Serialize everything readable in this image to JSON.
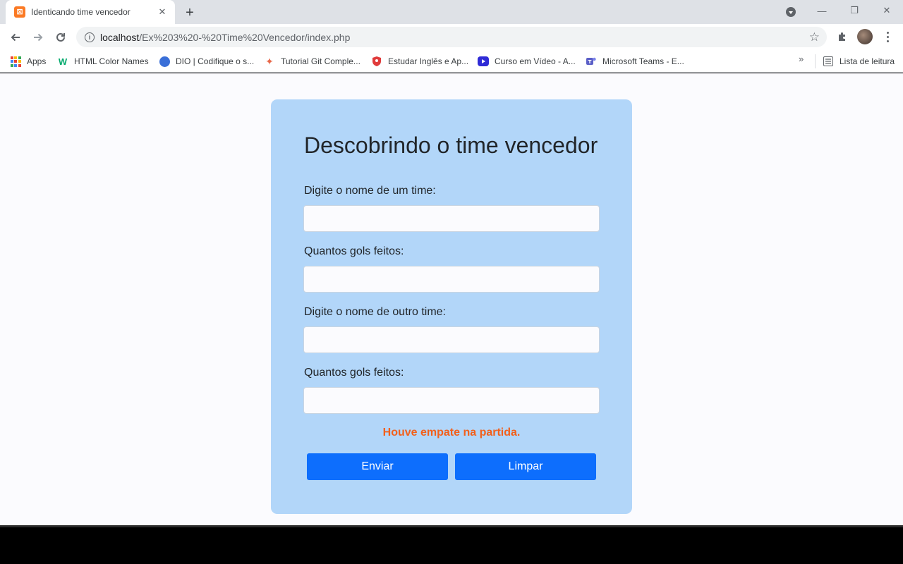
{
  "browser": {
    "tab": {
      "title": "Identicando time vencedor",
      "favicon_letter": "⊠"
    },
    "new_tab_symbol": "+",
    "window_buttons": {
      "minimize": "—",
      "restore": "❐",
      "close": "✕"
    },
    "url": {
      "host": "localhost",
      "path": "/Ex%203%20-%20Time%20Vencedor/index.php"
    },
    "bookmarks": [
      {
        "label": "Apps",
        "icon": "apps-grid-icon"
      },
      {
        "label": "HTML Color Names",
        "icon": "w3schools-icon",
        "color": "#04aa6d"
      },
      {
        "label": "DIO | Codifique o s...",
        "icon": "dio-icon",
        "color": "#3a6fd8"
      },
      {
        "label": "Tutorial Git Comple...",
        "icon": "git-icon",
        "color": "#e8684a"
      },
      {
        "label": "Estudar Inglês e Ap...",
        "icon": "shield-icon",
        "color": "#e03b3b"
      },
      {
        "label": "Curso em Vídeo - A...",
        "icon": "play-icon",
        "color": "#2f2bd6"
      },
      {
        "label": "Microsoft Teams - E...",
        "icon": "teams-icon",
        "color": "#5b5fc7"
      }
    ],
    "more_bookmarks_symbol": "»",
    "reading_list": {
      "label": "Lista de leitura",
      "icon": "reading-list-icon"
    }
  },
  "form": {
    "title": "Descobrindo o time vencedor",
    "fields": [
      {
        "label": "Digite o nome de um time:",
        "value": ""
      },
      {
        "label": "Quantos gols feitos:",
        "value": ""
      },
      {
        "label": "Digite o nome de outro time:",
        "value": ""
      },
      {
        "label": "Quantos gols feitos:",
        "value": ""
      }
    ],
    "result_message": "Houve empate na partida.",
    "submit_label": "Enviar",
    "clear_label": "Limpar"
  },
  "colors": {
    "card_background": "#b2d6f9",
    "button_primary": "#0d6efd",
    "result_message": "#f2601c"
  }
}
